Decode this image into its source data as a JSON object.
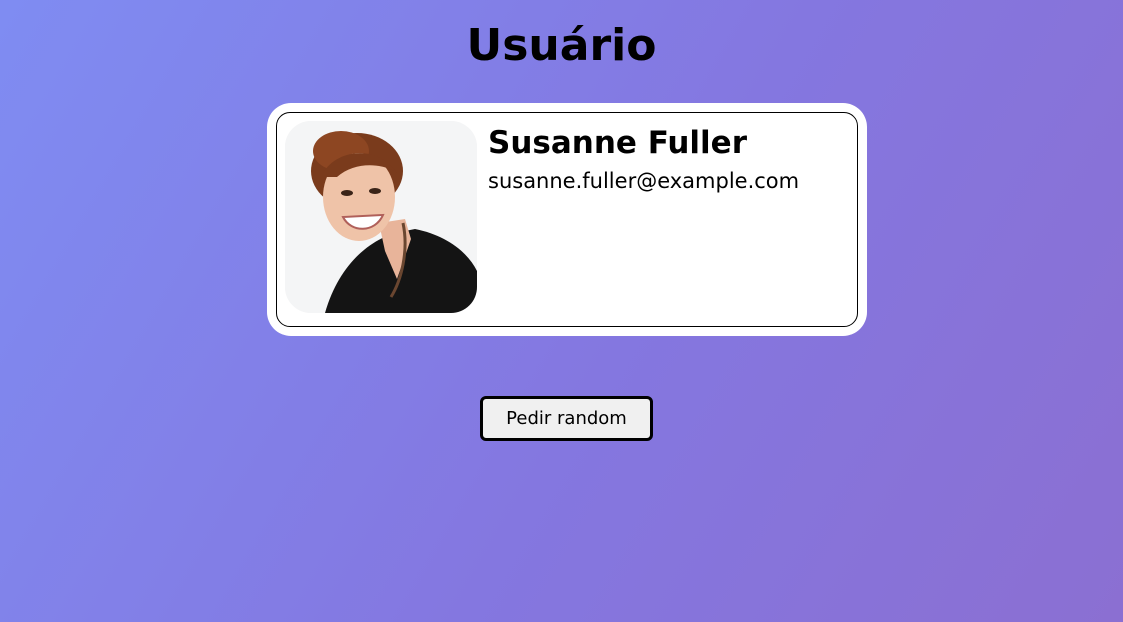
{
  "page": {
    "title": "Usuário"
  },
  "user": {
    "name": "Susanne Fuller",
    "email": "susanne.fuller@example.com",
    "photo_alt": "Susanne Fuller"
  },
  "actions": {
    "random_label": "Pedir random"
  },
  "theme": {
    "gradient_start": "#7f8cf2",
    "gradient_end": "#8b6fd2",
    "card_background": "#ffffff",
    "button_background": "#f0f0f0"
  }
}
